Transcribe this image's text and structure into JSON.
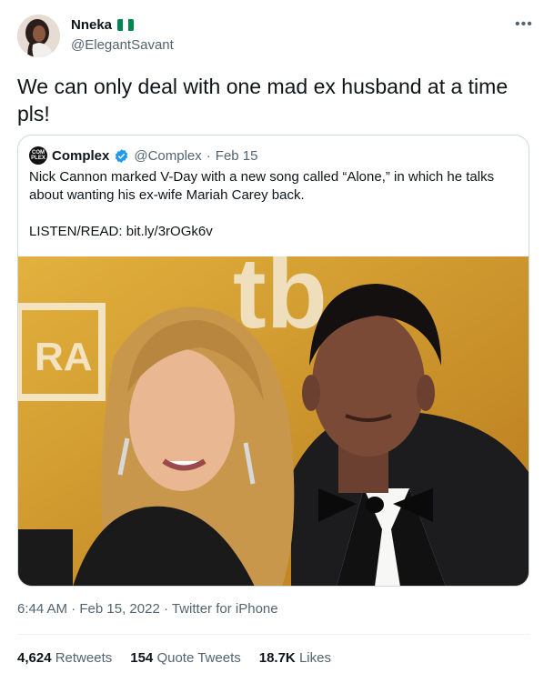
{
  "author": {
    "display_name": "Nneka",
    "handle": "@ElegantSavant",
    "flag_colors": [
      "#008751",
      "#ffffff",
      "#008751"
    ],
    "more_icon": "more-horizontal-icon"
  },
  "tweet": {
    "text": "We can only deal with one mad ex husband at a time pls!"
  },
  "quote": {
    "avatar_text": "COM PLEX",
    "name": "Complex",
    "handle": "@Complex",
    "separator": "·",
    "date": "Feb 15",
    "text_line1": "Nick Cannon marked V-Day with a new song called “Alone,” in which he talks about wanting his ex-wife Mariah Carey back.",
    "link_text": "LISTEN/READ: bit.ly/3rOGk6v",
    "verified_color": "#1d9bf0",
    "image_sign_text": "tb",
    "image_badge_text": "RA"
  },
  "meta": {
    "time": "6:44 AM",
    "date": "Feb 15, 2022",
    "source": "Twitter for iPhone",
    "sep": "·"
  },
  "stats": {
    "retweets_count": "4,624",
    "retweets_label": "Retweets",
    "quotes_count": "154",
    "quotes_label": "Quote Tweets",
    "likes_count": "18.7K",
    "likes_label": "Likes"
  }
}
